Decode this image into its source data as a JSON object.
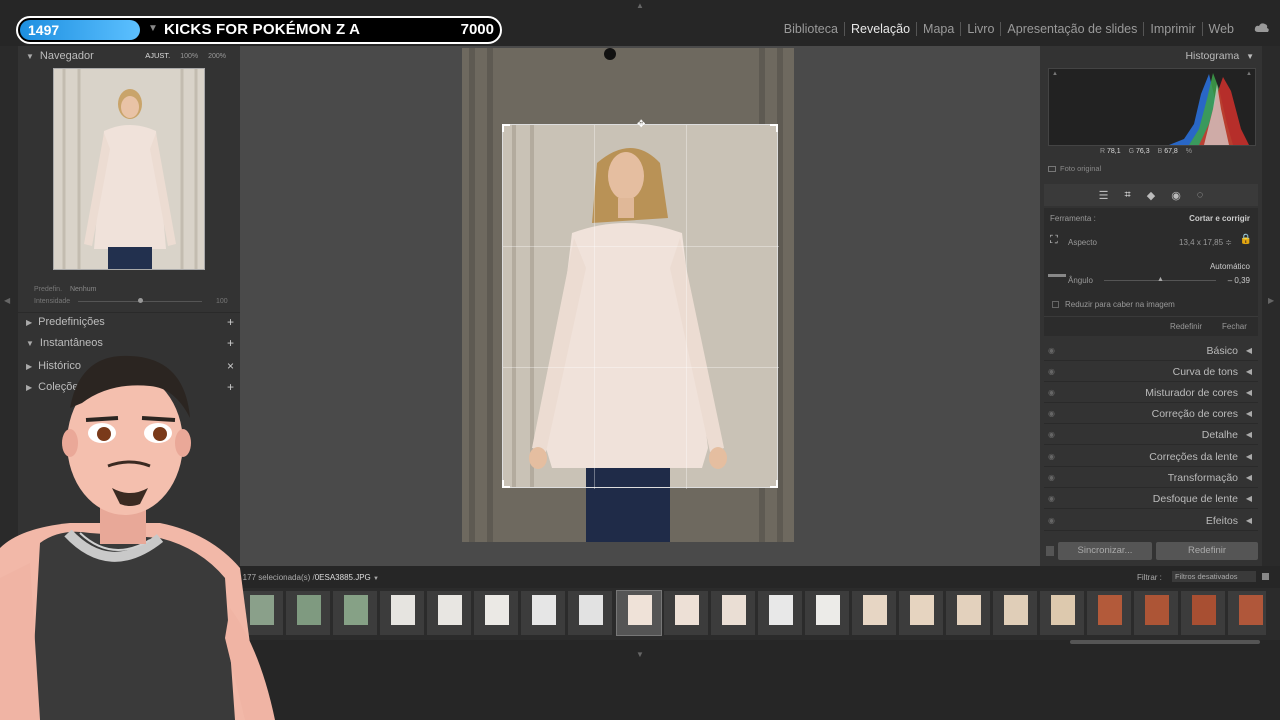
{
  "overlay": {
    "count": "1497",
    "title": "KICKS FOR POKÉMON Z A",
    "score": "7000"
  },
  "modules": {
    "items": [
      "Biblioteca",
      "Revelação",
      "Mapa",
      "Livro",
      "Apresentação de slides",
      "Imprimir",
      "Web"
    ],
    "active": "Revelação"
  },
  "left": {
    "navigator": {
      "label": "Navegador",
      "fit": "AJUST.",
      "z1": "100%",
      "z2": "200%"
    },
    "preset": {
      "label": "Predefin.",
      "value": "Nenhum",
      "amount": "Intensidade",
      "amount_value": "100"
    },
    "sections": [
      {
        "label": "Predefinições",
        "action": "+"
      },
      {
        "label": "Instantâneos",
        "action": "+"
      },
      {
        "label": "Histórico",
        "action": "×"
      },
      {
        "label": "Coleções",
        "action": "+"
      }
    ]
  },
  "right": {
    "histogram": {
      "label": "Histograma",
      "r_label": "R",
      "r": "78,1",
      "g_label": "G",
      "g": "76,3",
      "b_label": "B",
      "b": "67,8",
      "unit": "%",
      "original": "Foto original"
    },
    "crop": {
      "tool_label": "Ferramenta :",
      "tool_value": "Cortar e corrigir",
      "aspect_label": "Aspecto",
      "aspect_value": "13,4 x 17,85 ≑",
      "auto": "Automático",
      "angle_label": "Ângulo",
      "angle_value": "– 0,39",
      "constrain": "Reduzir para caber na imagem",
      "reset": "Redefinir",
      "close": "Fechar"
    },
    "sections": [
      "Básico",
      "Curva de tons",
      "Misturador de cores",
      "Correção de cores",
      "Detalhe",
      "Correções da lente",
      "Transformação",
      "Desfoque de lente",
      "Efeitos"
    ],
    "sync": "Sincronizar...",
    "reset": "Redefinir"
  },
  "filmstrip": {
    "info": "s / 177 selecionada(s) /",
    "filename": "0ESA3885.JPG",
    "filter_label": "Filtrar :",
    "filter_value": "Filtros desativados"
  },
  "colors": {
    "accent": "#1d8fe0",
    "panel": "#333333",
    "bg": "#262626",
    "canvas": "#4a4a4a"
  }
}
